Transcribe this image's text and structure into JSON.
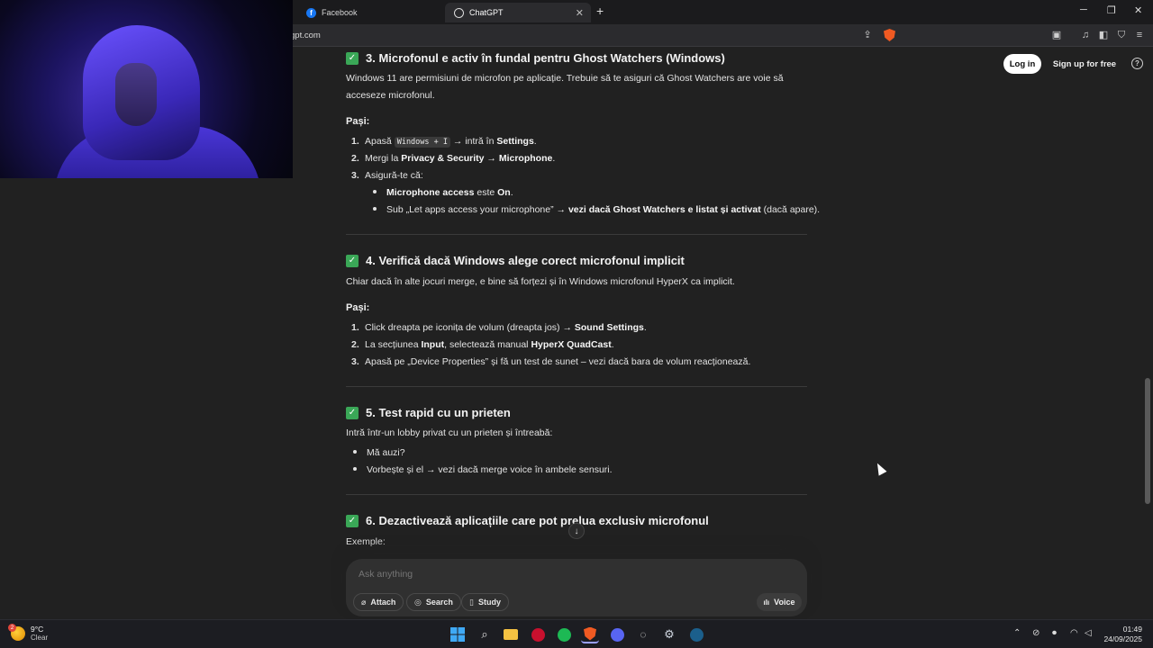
{
  "browser": {
    "tabs": [
      {
        "label": "Facebook",
        "active": false
      },
      {
        "label": "ChatGPT",
        "active": true
      }
    ],
    "url": "gpt.com"
  },
  "auth": {
    "login_label": "Log in",
    "signup_label": "Sign up for free",
    "help_label": "?"
  },
  "sections": {
    "s3": {
      "heading": "3. Microfonul e activ în fundal pentru Ghost Watchers (Windows)",
      "intro": "Windows 11 are permisiuni de microfon pe aplicație. Trebuie să te asiguri că Ghost Watchers are voie să acceseze microfonul.",
      "steps_label": "Pași:",
      "step1": {
        "num": "1.",
        "pre": "Apasă ",
        "code": "Windows + I",
        "mid": " → intră în ",
        "bold": "Settings",
        "post": "."
      },
      "step2": {
        "num": "2.",
        "pre": "Mergi la ",
        "bold1": "Privacy & Security",
        "mid": " → ",
        "bold2": "Microphone",
        "post": "."
      },
      "step3": {
        "num": "3.",
        "text": "Asigură-te că:"
      },
      "sub1": {
        "bold": "Microphone access",
        "mid": " este ",
        "bold2": "On",
        "post": "."
      },
      "sub2": {
        "pre": "Sub „Let apps access your microphone” → ",
        "bold": "vezi dacă Ghost Watchers e listat și activat",
        "post": " (dacă apare)."
      }
    },
    "s4": {
      "heading": "4. Verifică dacă Windows alege corect microfonul implicit",
      "intro": "Chiar dacă în alte jocuri merge, e bine să forțezi și în Windows microfonul HyperX ca implicit.",
      "steps_label": "Pași:",
      "step1": {
        "num": "1.",
        "pre": "Click dreapta pe iconița de volum (dreapta jos) → ",
        "bold": "Sound Settings",
        "post": "."
      },
      "step2": {
        "num": "2.",
        "pre": "La secțiunea ",
        "bold1": "Input",
        "mid": ", selectează manual ",
        "bold2": "HyperX QuadCast",
        "post": "."
      },
      "step3": {
        "num": "3.",
        "text": "Apasă pe „Device Properties” și fă un test de sunet – vezi dacă bara de volum reacționează."
      }
    },
    "s5": {
      "heading": "5. Test rapid cu un prieten",
      "intro": "Intră într-un lobby privat cu un prieten și întreabă:",
      "b1": "Mă auzi?",
      "b2": "Vorbește și el → vezi dacă merge voice în ambele sensuri."
    },
    "s6": {
      "heading": "6. Dezactivează aplicațiile care pot prelua exclusiv microfonul",
      "intro": "Exemple:"
    }
  },
  "composer": {
    "placeholder": "Ask anything",
    "attach_label": "Attach",
    "search_label": "Search",
    "study_label": "Study",
    "voice_label": "Voice"
  },
  "taskbar": {
    "weather_temp": "9°C",
    "weather_desc": "Clear",
    "weather_badge": "2",
    "time": "01:49",
    "date": "24/09/2025"
  },
  "colors": {
    "background": "#212121",
    "check_green": "#3aa757",
    "brave_orange": "#f05a22"
  }
}
